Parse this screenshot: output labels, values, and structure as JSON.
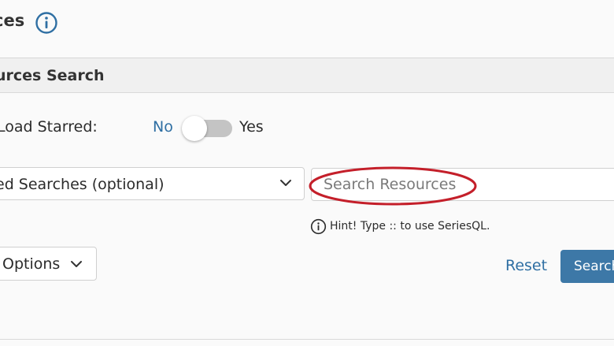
{
  "page": {
    "title": "ces"
  },
  "panel": {
    "header": "urces Search"
  },
  "starred": {
    "label": "Load Starred:",
    "no_label": "No",
    "yes_label": "Yes",
    "state": "off"
  },
  "saved_searches": {
    "selected": "ed Searches (optional)"
  },
  "search": {
    "placeholder": "Search Resources",
    "value": "",
    "hint": "Hint! Type :: to use SeriesQL."
  },
  "actions": {
    "options_label": "Options",
    "reset_label": "Reset",
    "search_label": "Search"
  },
  "colors": {
    "accent": "#2f6fa3",
    "primary_button": "#3d78a7",
    "highlight_ellipse": "#c41f2a"
  },
  "icons": {
    "title_info": "info-icon",
    "hint_info": "info-icon",
    "dropdown": "chevron-down-icon"
  }
}
